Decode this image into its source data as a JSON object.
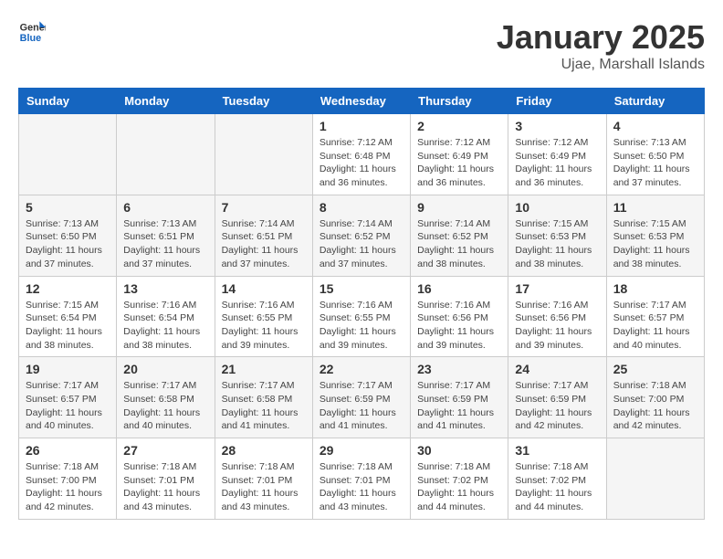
{
  "header": {
    "logo_general": "General",
    "logo_blue": "Blue",
    "month_title": "January 2025",
    "location": "Ujae, Marshall Islands"
  },
  "days_of_week": [
    "Sunday",
    "Monday",
    "Tuesday",
    "Wednesday",
    "Thursday",
    "Friday",
    "Saturday"
  ],
  "weeks": [
    [
      {
        "day": "",
        "info": ""
      },
      {
        "day": "",
        "info": ""
      },
      {
        "day": "",
        "info": ""
      },
      {
        "day": "1",
        "info": "Sunrise: 7:12 AM\nSunset: 6:48 PM\nDaylight: 11 hours\nand 36 minutes."
      },
      {
        "day": "2",
        "info": "Sunrise: 7:12 AM\nSunset: 6:49 PM\nDaylight: 11 hours\nand 36 minutes."
      },
      {
        "day": "3",
        "info": "Sunrise: 7:12 AM\nSunset: 6:49 PM\nDaylight: 11 hours\nand 36 minutes."
      },
      {
        "day": "4",
        "info": "Sunrise: 7:13 AM\nSunset: 6:50 PM\nDaylight: 11 hours\nand 37 minutes."
      }
    ],
    [
      {
        "day": "5",
        "info": "Sunrise: 7:13 AM\nSunset: 6:50 PM\nDaylight: 11 hours\nand 37 minutes."
      },
      {
        "day": "6",
        "info": "Sunrise: 7:13 AM\nSunset: 6:51 PM\nDaylight: 11 hours\nand 37 minutes."
      },
      {
        "day": "7",
        "info": "Sunrise: 7:14 AM\nSunset: 6:51 PM\nDaylight: 11 hours\nand 37 minutes."
      },
      {
        "day": "8",
        "info": "Sunrise: 7:14 AM\nSunset: 6:52 PM\nDaylight: 11 hours\nand 37 minutes."
      },
      {
        "day": "9",
        "info": "Sunrise: 7:14 AM\nSunset: 6:52 PM\nDaylight: 11 hours\nand 38 minutes."
      },
      {
        "day": "10",
        "info": "Sunrise: 7:15 AM\nSunset: 6:53 PM\nDaylight: 11 hours\nand 38 minutes."
      },
      {
        "day": "11",
        "info": "Sunrise: 7:15 AM\nSunset: 6:53 PM\nDaylight: 11 hours\nand 38 minutes."
      }
    ],
    [
      {
        "day": "12",
        "info": "Sunrise: 7:15 AM\nSunset: 6:54 PM\nDaylight: 11 hours\nand 38 minutes."
      },
      {
        "day": "13",
        "info": "Sunrise: 7:16 AM\nSunset: 6:54 PM\nDaylight: 11 hours\nand 38 minutes."
      },
      {
        "day": "14",
        "info": "Sunrise: 7:16 AM\nSunset: 6:55 PM\nDaylight: 11 hours\nand 39 minutes."
      },
      {
        "day": "15",
        "info": "Sunrise: 7:16 AM\nSunset: 6:55 PM\nDaylight: 11 hours\nand 39 minutes."
      },
      {
        "day": "16",
        "info": "Sunrise: 7:16 AM\nSunset: 6:56 PM\nDaylight: 11 hours\nand 39 minutes."
      },
      {
        "day": "17",
        "info": "Sunrise: 7:16 AM\nSunset: 6:56 PM\nDaylight: 11 hours\nand 39 minutes."
      },
      {
        "day": "18",
        "info": "Sunrise: 7:17 AM\nSunset: 6:57 PM\nDaylight: 11 hours\nand 40 minutes."
      }
    ],
    [
      {
        "day": "19",
        "info": "Sunrise: 7:17 AM\nSunset: 6:57 PM\nDaylight: 11 hours\nand 40 minutes."
      },
      {
        "day": "20",
        "info": "Sunrise: 7:17 AM\nSunset: 6:58 PM\nDaylight: 11 hours\nand 40 minutes."
      },
      {
        "day": "21",
        "info": "Sunrise: 7:17 AM\nSunset: 6:58 PM\nDaylight: 11 hours\nand 41 minutes."
      },
      {
        "day": "22",
        "info": "Sunrise: 7:17 AM\nSunset: 6:59 PM\nDaylight: 11 hours\nand 41 minutes."
      },
      {
        "day": "23",
        "info": "Sunrise: 7:17 AM\nSunset: 6:59 PM\nDaylight: 11 hours\nand 41 minutes."
      },
      {
        "day": "24",
        "info": "Sunrise: 7:17 AM\nSunset: 6:59 PM\nDaylight: 11 hours\nand 42 minutes."
      },
      {
        "day": "25",
        "info": "Sunrise: 7:18 AM\nSunset: 7:00 PM\nDaylight: 11 hours\nand 42 minutes."
      }
    ],
    [
      {
        "day": "26",
        "info": "Sunrise: 7:18 AM\nSunset: 7:00 PM\nDaylight: 11 hours\nand 42 minutes."
      },
      {
        "day": "27",
        "info": "Sunrise: 7:18 AM\nSunset: 7:01 PM\nDaylight: 11 hours\nand 43 minutes."
      },
      {
        "day": "28",
        "info": "Sunrise: 7:18 AM\nSunset: 7:01 PM\nDaylight: 11 hours\nand 43 minutes."
      },
      {
        "day": "29",
        "info": "Sunrise: 7:18 AM\nSunset: 7:01 PM\nDaylight: 11 hours\nand 43 minutes."
      },
      {
        "day": "30",
        "info": "Sunrise: 7:18 AM\nSunset: 7:02 PM\nDaylight: 11 hours\nand 44 minutes."
      },
      {
        "day": "31",
        "info": "Sunrise: 7:18 AM\nSunset: 7:02 PM\nDaylight: 11 hours\nand 44 minutes."
      },
      {
        "day": "",
        "info": ""
      }
    ]
  ]
}
